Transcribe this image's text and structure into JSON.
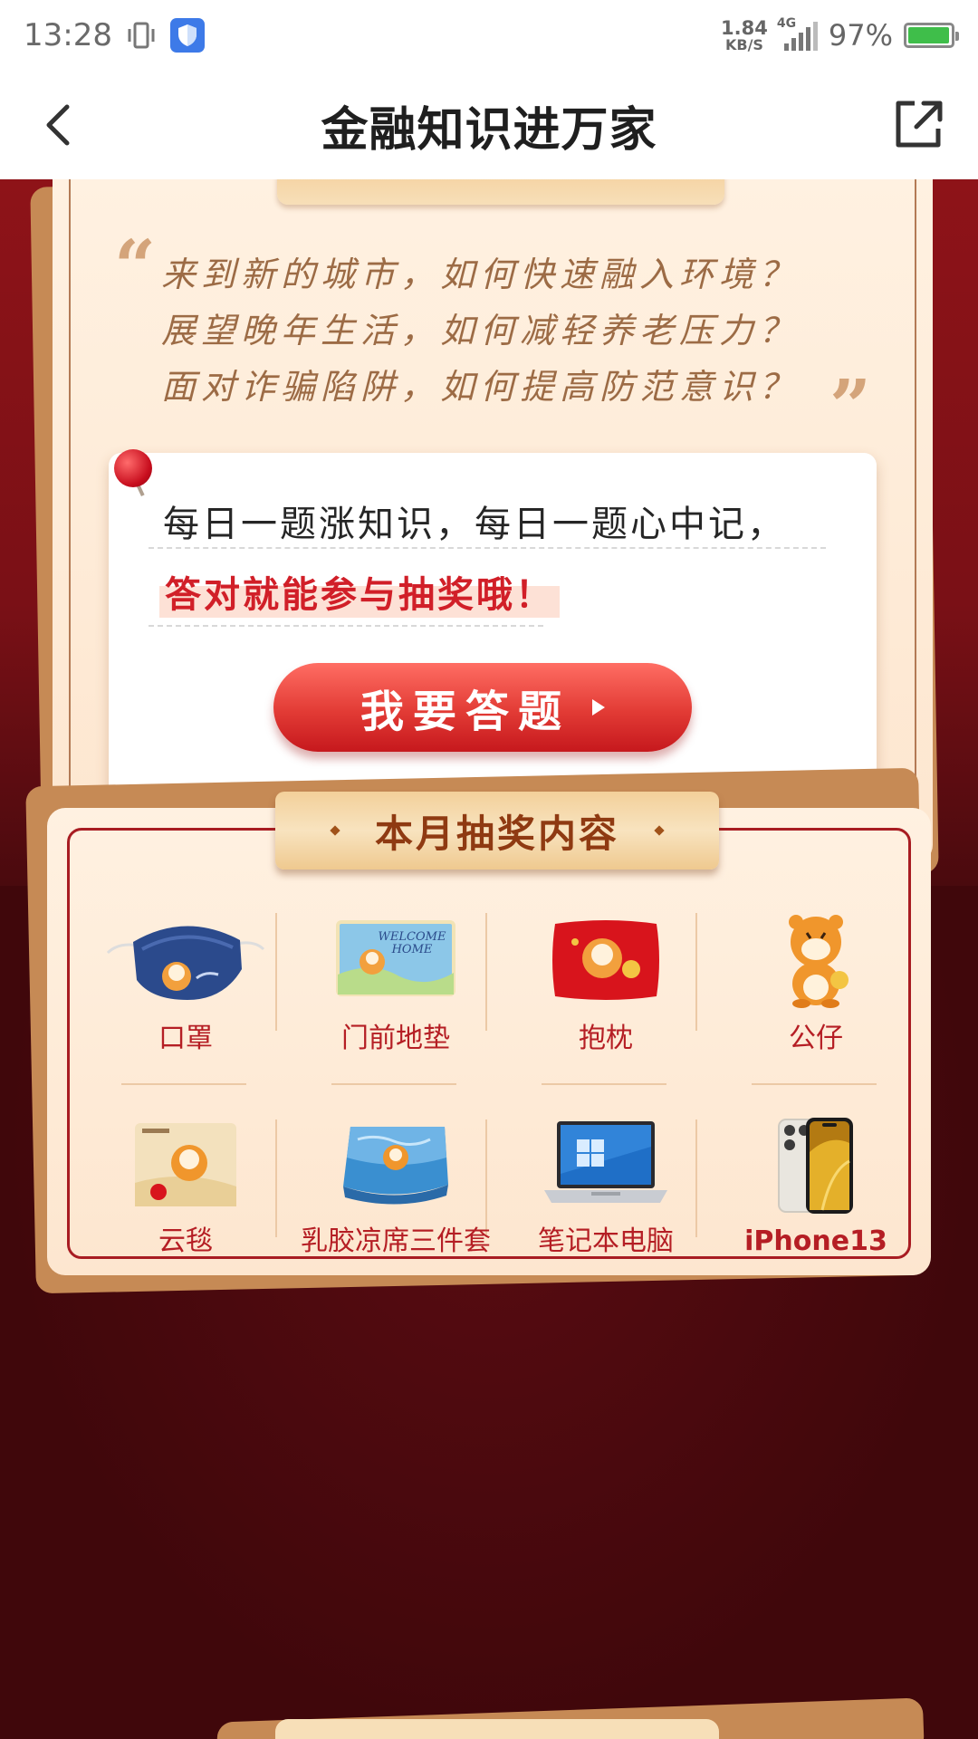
{
  "status_bar": {
    "time": "13:28",
    "net_speed_value": "1.84",
    "net_speed_unit": "KB/S",
    "network": "4G",
    "battery_pct": "97%",
    "battery_level": 0.97
  },
  "nav": {
    "title": "金融知识进万家"
  },
  "intro": {
    "lines": [
      "来到新的城市，如何快速融入环境？",
      "展望晚年生活，如何减轻养老压力？",
      "面对诈骗陷阱，如何提高防范意识？"
    ]
  },
  "quiz": {
    "line1": "每日一题涨知识，每日一题心中记，",
    "line2": "答对就能参与抽奖哦！",
    "button_label": "我要答题"
  },
  "prizes": {
    "title": "本月抽奖内容",
    "items": [
      {
        "name": "口罩",
        "icon": "mask-image"
      },
      {
        "name": "门前地垫",
        "icon": "doormat-image"
      },
      {
        "name": "抱枕",
        "icon": "pillow-image"
      },
      {
        "name": "公仔",
        "icon": "tiger-doll-image"
      },
      {
        "name": "云毯",
        "icon": "blanket-image"
      },
      {
        "name": "乳胶凉席三件套",
        "icon": "latex-mat-image"
      },
      {
        "name": "笔记本电脑",
        "icon": "laptop-image"
      },
      {
        "name": "iPhone13",
        "icon": "iphone-image"
      }
    ]
  },
  "colors": {
    "accent_red": "#d11f28",
    "background_dark": "#4a0a0e",
    "card_cream": "#fde6cf"
  }
}
